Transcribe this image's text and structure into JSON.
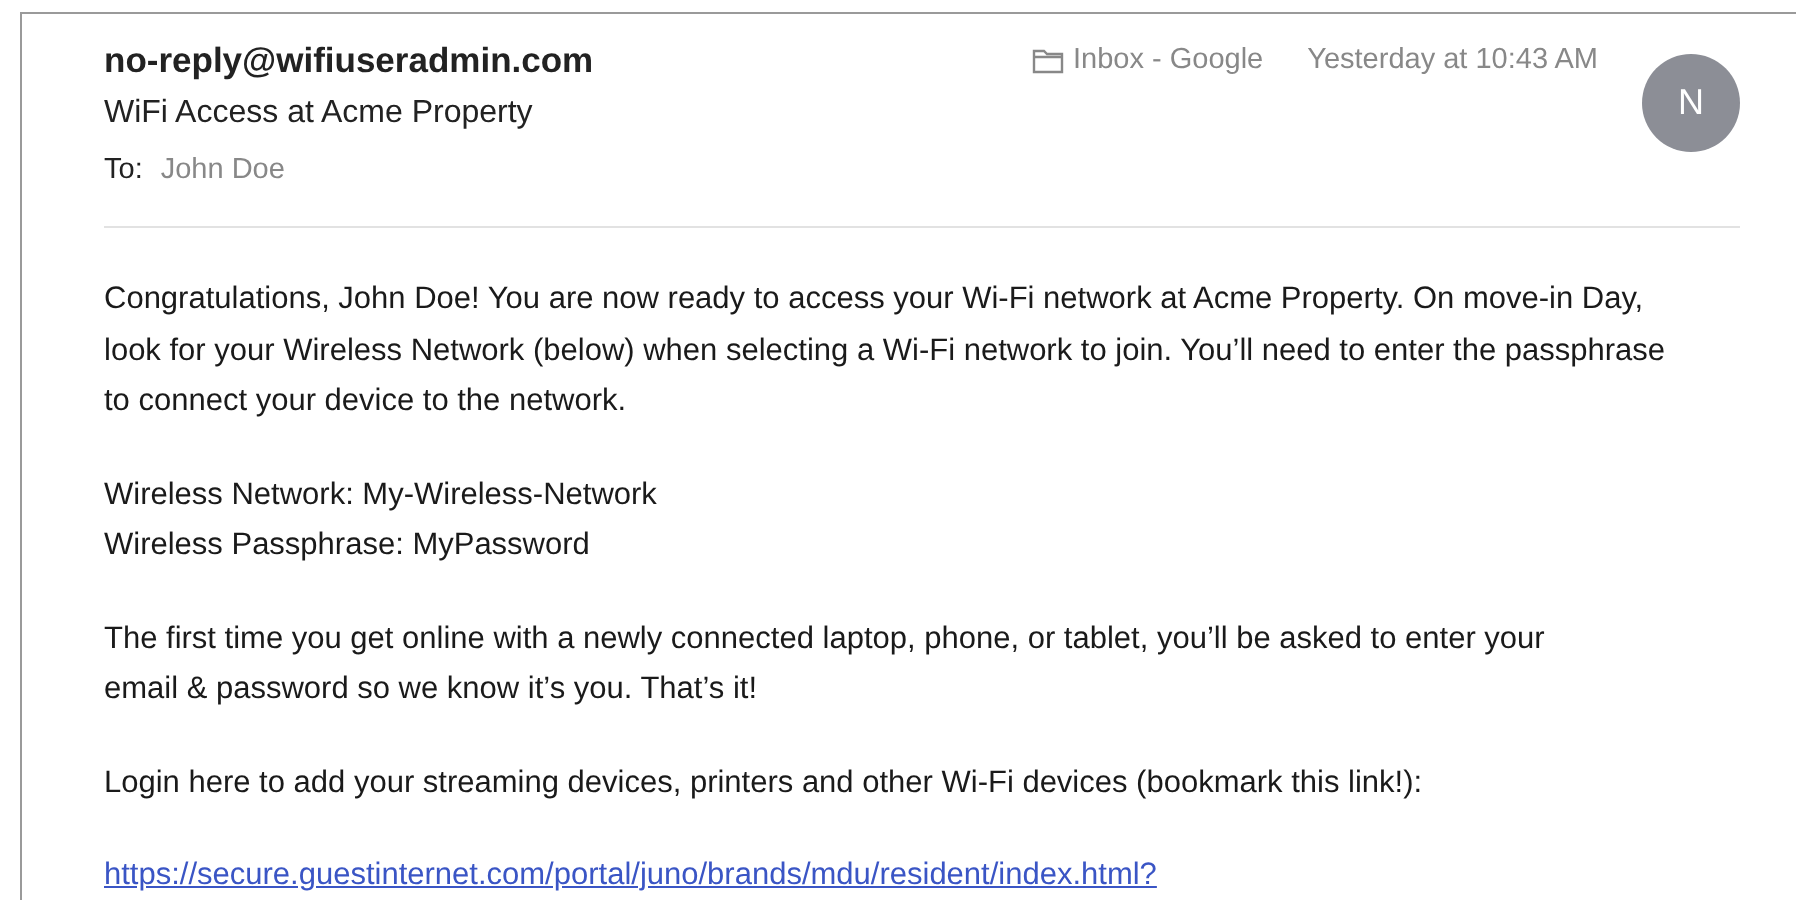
{
  "header": {
    "sender": "no-reply@wifiuseradmin.com",
    "subject": "WiFi Access at Acme Property",
    "to_label": "To:",
    "to": "John Doe",
    "mailbox": "Inbox - Google",
    "time": "Yesterday at 10:43 AM",
    "avatar": "N"
  },
  "body": [
    {
      "kind": "text",
      "lines": [
        "Congratulations, John Doe! You are now ready to access your Wi-Fi network at Acme Property. On move-in Day,",
        "look for your Wireless Network (below) when selecting a Wi-Fi network to join. You’ll need to enter the passphrase",
        "to connect your device to the network."
      ]
    },
    {
      "kind": "text",
      "lines": [
        "Wireless Network: My-Wireless-Network",
        "Wireless Passphrase: MyPassword"
      ]
    },
    {
      "kind": "text",
      "lines": [
        "The first time you get online with a newly connected laptop, phone, or tablet, you’ll be asked to enter your",
        "email & password so we know it’s you. That’s it!"
      ]
    },
    {
      "kind": "text",
      "lines": [
        "Login here to add your streaming devices, printers and other Wi-Fi devices (bookmark this link!):"
      ]
    },
    {
      "kind": "link",
      "lines": [
        "https://secure.guestinternet.com/portal/juno/brands/mdu/resident/index.html?"
      ]
    }
  ]
}
